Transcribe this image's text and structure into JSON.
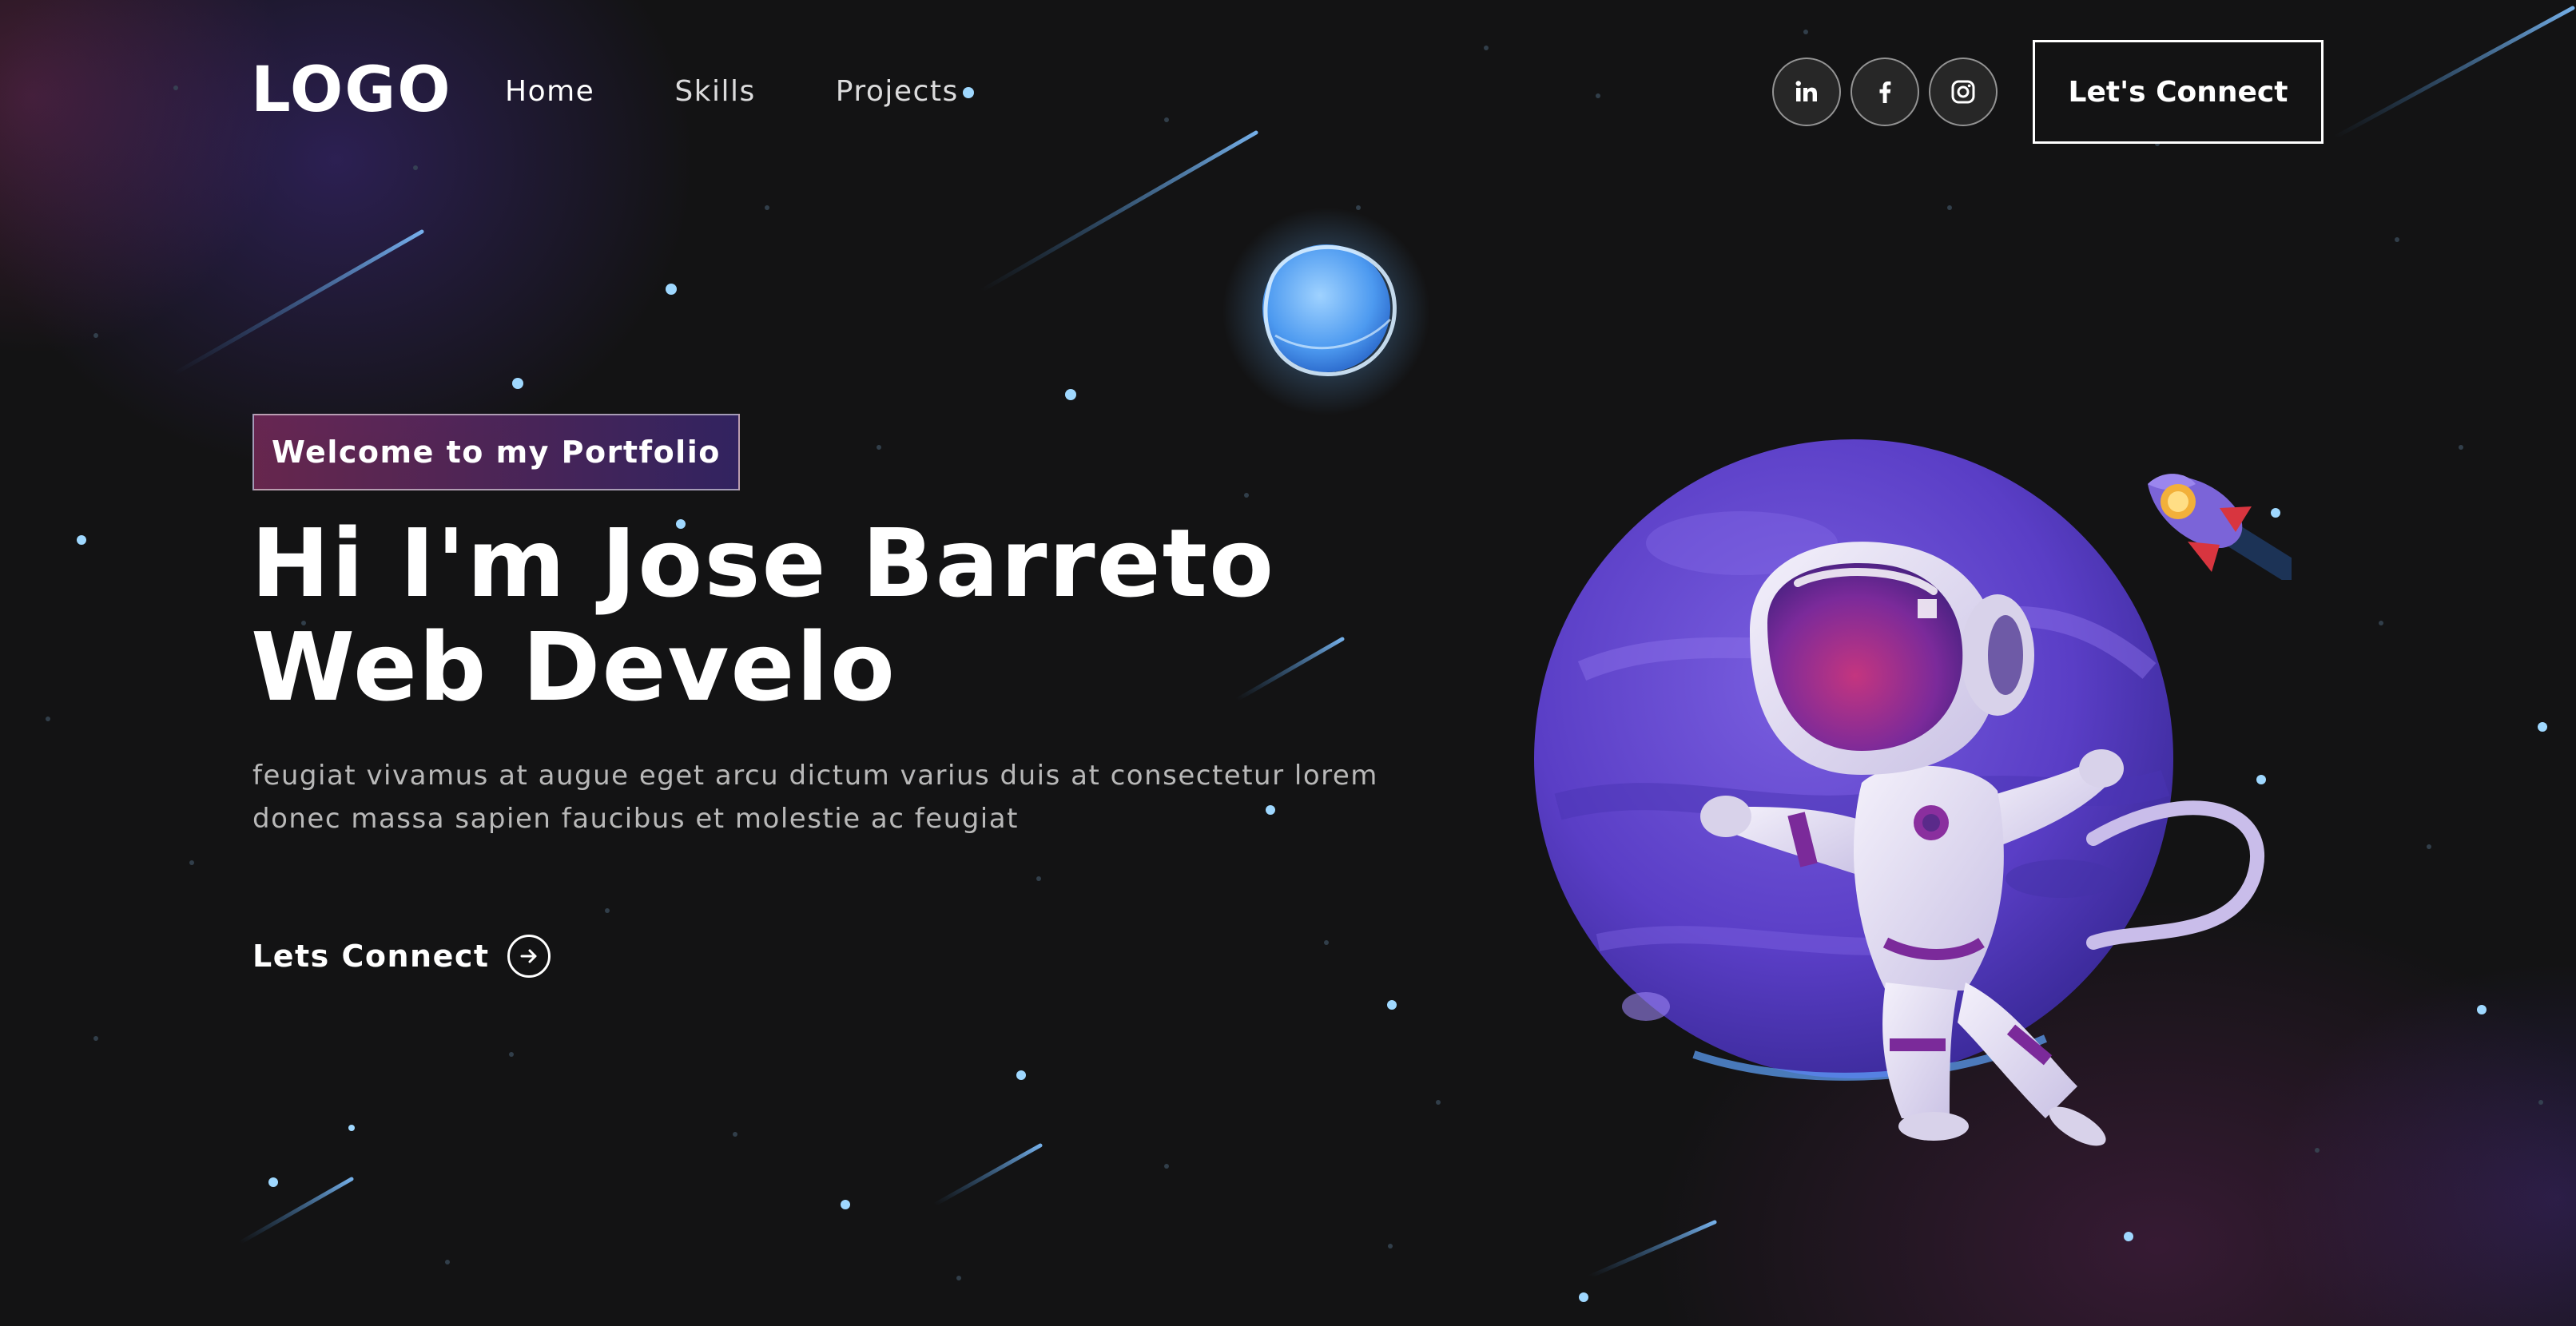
{
  "brand": {
    "logo": "LOGO"
  },
  "nav": {
    "links": [
      "Home",
      "Skills",
      "Projects"
    ],
    "active": "Home",
    "socials": [
      {
        "name": "linkedin",
        "icon": "linkedin-icon",
        "glyph": "in"
      },
      {
        "name": "facebook",
        "icon": "facebook-icon",
        "glyph": "f"
      },
      {
        "name": "instagram",
        "icon": "instagram-icon"
      }
    ],
    "connect_label": "Let's Connect"
  },
  "hero": {
    "tagline": "Welcome to my Portfolio",
    "headline_line1": "Hi I'm Jose Barreto",
    "headline_line2": "Web Develo",
    "intro_line1": "feugiat vivamus at augue eget arcu dictum varius duis at consectetur lorem",
    "intro_line2": "donec massa sapien faucibus et molestie ac feugiat",
    "cta_label": "Lets Connect"
  },
  "illustration": {
    "subject": "astronaut floating in front of a purple planet",
    "icons": [
      "planet-icon",
      "astronaut-illustration",
      "rocket-icon",
      "glowing-moon-icon",
      "shooting-star-icon"
    ]
  },
  "colors": {
    "background": "#131314",
    "accent_pink": "#AA367C",
    "accent_purple": "#4A2FBD",
    "planet": "#5B3FC4",
    "moon_glow": "#6BB6FF",
    "text_muted": "#B8B8B8"
  }
}
